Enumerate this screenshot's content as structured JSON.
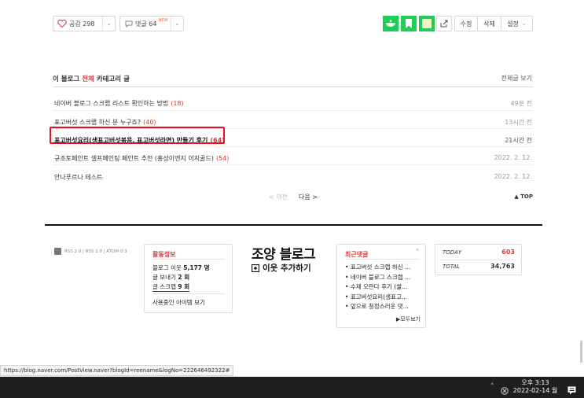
{
  "actions": {
    "like_label": "공감 298",
    "comment_label": "댓글 64",
    "comment_new_badge": "NEW",
    "edit_label": "수정",
    "delete_label": "삭제",
    "settings_label": "설정"
  },
  "category": {
    "header_prefix": "이 블로그",
    "header_highlight": "전체",
    "header_suffix": "카테고리 글",
    "view_all": "전체글 보기",
    "posts": [
      {
        "title": "네이버 블로그 스크랩 리스트 확인하는 방법",
        "count": "(18)",
        "time": "49분 전",
        "bold": false
      },
      {
        "title": "표고버섯 스크랩 하신 분 누구죠?",
        "count": "(40)",
        "time": "13시간 전",
        "bold": false
      },
      {
        "title": "표고버섯요리(생표고버섯볶음, 표고버섯라면) 만들기 후기",
        "count": "(64)",
        "time": "21시간 전",
        "bold": true
      },
      {
        "title": "규조토페인트 셀프페인팅 페인트 추천 (홍성이엔지 이지골드)",
        "count": "(54)",
        "time": "2022. 2. 12.",
        "bold": false
      },
      {
        "title": "안나푸르나 테스트",
        "count": "",
        "time": "2022. 2. 12.",
        "bold": false
      }
    ],
    "prev_label": "< 이전",
    "next_label": "다음 >",
    "top_label": "▲ TOP"
  },
  "footer": {
    "rss": "RSS 2.0 | RSS 1.0 | ATOM 0.3",
    "activity": {
      "title": "활동정보",
      "neighbors_label": "블로그 이웃",
      "neighbors_value": "5,177 명",
      "posts_label": "글 보내기",
      "posts_value": "2 회",
      "scrap_label": "글 스크랩",
      "scrap_value": "9 회",
      "nicknames_label": "사용중인 아이템 보기"
    },
    "blog_name": "조양 블로그",
    "add_neighbor": "이웃 추가하기",
    "recent_comments": {
      "title": "최근댓글",
      "items": [
        "표고버섯 스크랩 하신 ...",
        "네이버 블로그 스크랩 ...",
        "수제 오란다 후기 (쌀...",
        "표고버섯요리(생표고...",
        "앞으로 청정스러운 댓..."
      ],
      "more_label": "▶모두보기"
    },
    "stats": {
      "today_label": "TODAY",
      "today_value": "603",
      "total_label": "TOTAL",
      "total_value": "34,763"
    }
  },
  "status_url": "https://blog.naver.com/PostView.naver?blogId=reename&logNo=222646492322#",
  "taskbar": {
    "time": "오후 3:13",
    "date": "2022-02-14 월"
  },
  "colors": {
    "accent_red": "#d23b3b",
    "naver_green": "#1fcc56",
    "highlight_box": "#e0131b",
    "taskbar_bg": "#1f1f1f"
  }
}
